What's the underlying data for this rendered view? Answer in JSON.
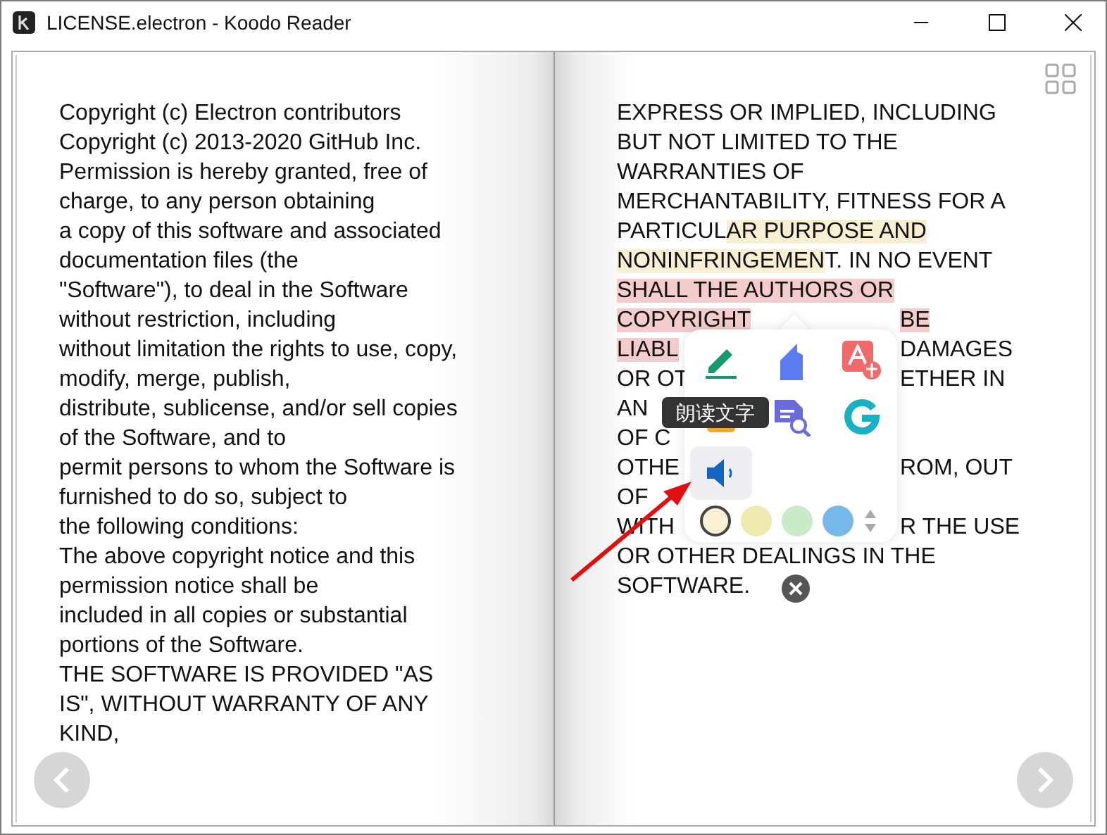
{
  "window": {
    "title": "LICENSE.electron - Koodo Reader"
  },
  "left_page": {
    "lines": [
      "Copyright (c) Electron contributors",
      "Copyright (c) 2013-2020 GitHub Inc.",
      "Permission is hereby granted, free of",
      "charge, to any person obtaining",
      "a copy of this software and associated",
      "documentation files (the",
      "\"Software\"), to deal in the Software",
      "without restriction, including",
      "without limitation the rights to use, copy,",
      "modify, merge, publish,",
      "distribute, sublicense, and/or sell copies",
      "of the Software, and to",
      "permit persons to whom the Software is",
      "furnished to do so, subject to",
      "the following conditions:",
      "The above copyright notice and this",
      "permission notice shall be",
      "included in all copies or substantial",
      "portions of the Software.",
      "THE SOFTWARE IS PROVIDED \"AS",
      "IS\", WITHOUT WARRANTY OF ANY",
      "KIND,"
    ]
  },
  "right_page": {
    "lines": [
      {
        "before": [
          {
            "text": "EXPRESS OR IMPLIED, INCLUDING"
          }
        ]
      },
      {
        "before": [
          {
            "text": "BUT NOT LIMITED TO THE"
          }
        ]
      },
      {
        "before": [
          {
            "text": "WARRANTIES OF"
          }
        ]
      },
      {
        "before": [
          {
            "text": "MERCHANTABILITY, FITNESS FOR A"
          }
        ]
      },
      {
        "before": [
          {
            "text": "PARTICUL"
          },
          {
            "text": "AR PURPOSE AND",
            "color": "#fbefd3"
          }
        ]
      },
      {
        "before": [
          {
            "text": "NONINFRINGEMEN",
            "color": "#fbefd3"
          },
          {
            "text": "T. IN NO EVENT"
          }
        ]
      },
      {
        "before": [
          {
            "text": "SHALL THE AUTHORS OR",
            "color": "#f4cccc"
          }
        ]
      },
      {
        "before": [
          {
            "text": "COPYRIGHT",
            "color": "#f4cccc"
          }
        ],
        "after": [
          {
            "text": "BE",
            "color": "#f4cccc"
          }
        ]
      },
      {
        "before": [
          {
            "text": "LIABL",
            "color": "#f4cccc"
          }
        ],
        "after": [
          {
            "text": "DAMAGES"
          }
        ]
      },
      {
        "before": [
          {
            "text": "OR OT"
          }
        ],
        "after": [
          {
            "text": "ETHER IN"
          }
        ]
      },
      {
        "before": [
          {
            "text": "AN"
          }
        ]
      },
      {
        "before": [
          {
            "text": "OF C"
          }
        ]
      },
      {
        "before": [
          {
            "text": "OTHE"
          }
        ],
        "after": [
          {
            "text": "ROM, OUT"
          }
        ]
      },
      {
        "before": [
          {
            "text": "OF"
          }
        ]
      },
      {
        "before": [
          {
            "text": "WITH"
          }
        ],
        "after": [
          {
            "text": "R THE USE"
          }
        ]
      },
      {
        "before": [
          {
            "text": "OR OTHER DEALINGS IN THE"
          }
        ]
      },
      {
        "before": [
          {
            "text": "SOFTWARE."
          }
        ]
      }
    ]
  },
  "popup": {
    "tools": [
      {
        "kind": "note",
        "selected": false
      },
      {
        "kind": "highlight",
        "selected": false
      },
      {
        "kind": "translate",
        "selected": false
      },
      {
        "kind": "copy",
        "selected": false
      },
      {
        "kind": "search",
        "selected": false
      },
      {
        "kind": "google",
        "selected": false
      },
      {
        "kind": "speak",
        "selected": true
      }
    ],
    "colors": [
      {
        "color": "#fbf0d4",
        "selected": true
      },
      {
        "color": "#eeeab0",
        "selected": false
      },
      {
        "color": "#c9ebc8",
        "selected": false
      },
      {
        "color": "#76b9e8",
        "selected": false
      }
    ],
    "tooltip": "朗读文字"
  }
}
